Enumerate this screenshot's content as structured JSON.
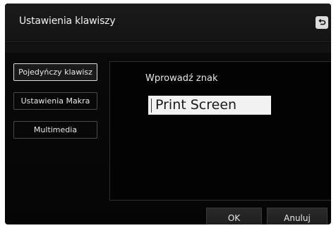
{
  "dialog": {
    "title": "Ustawienia klawiszy",
    "back_icon": "return-arrow-icon"
  },
  "sidebar": {
    "items": [
      {
        "label": "Pojedyńczy klawisz",
        "active": true
      },
      {
        "label": "Ustawienia Makra",
        "active": false
      },
      {
        "label": "Multimedia",
        "active": false
      }
    ]
  },
  "main": {
    "prompt": "Wprowadź znak",
    "key_value": "Print Screen"
  },
  "footer": {
    "ok_label": "OK",
    "cancel_label": "Anuluj"
  },
  "colors": {
    "background": "#050505",
    "text": "#e8e8e8",
    "field_bg": "#f2f2f2"
  }
}
